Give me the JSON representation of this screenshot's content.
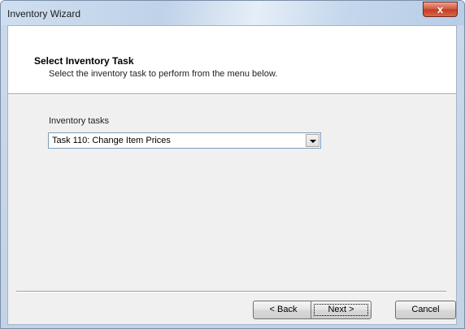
{
  "window": {
    "title": "Inventory Wizard",
    "close_glyph": "x"
  },
  "header": {
    "title": "Select Inventory Task",
    "subtitle": "Select the inventory task to perform from the menu below."
  },
  "tasks": {
    "label": "Inventory tasks",
    "selected": "Task 110: Change Item Prices"
  },
  "buttons": {
    "back": "< Back",
    "next": "Next >",
    "cancel": "Cancel"
  },
  "icons": {
    "close": "close-icon",
    "dropdown": "chevron-down-icon"
  },
  "colors": {
    "close_button": "#c43b22",
    "titlebar": "#c3d3e6",
    "dialog_face": "#f0f0f0"
  }
}
